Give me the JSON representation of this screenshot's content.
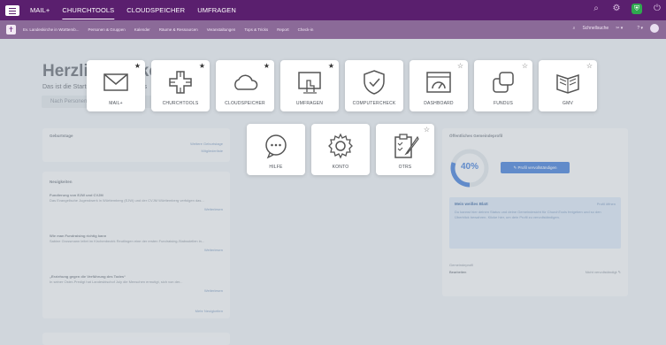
{
  "topnav": {
    "items": [
      "MAIL+",
      "CHURCHTOOLS",
      "CLOUDSPEICHER",
      "UMFRAGEN"
    ],
    "active": "CHURCHTOOLS"
  },
  "subbar": {
    "items": [
      "Ev. Landeskirche in Württemb...",
      "Personen & Gruppen",
      "Kalender",
      "Räume & Ressourcen",
      "Veranstaltungen",
      "Tops & Tricks",
      "Report",
      "Check-in"
    ],
    "search_placeholder": "Schnellsuche",
    "help": "?"
  },
  "dashboard": {
    "greeting": "Herzlich willkommen",
    "subtitle": "Das ist die Startseite von ChurchTools",
    "search_placeholder": "Nach Personen suchen",
    "birthdays": {
      "title": "Geburtstage",
      "link1": "Weitere Geburtstage",
      "link2": "Mitgliederliste"
    },
    "news": {
      "title": "Neuigkeiten",
      "items": [
        {
          "headline": "Fundierung von EJW und CVJM",
          "text": "Das Evangelische Jugendwerk in Württemberg (EJW) und der CVJM Württemberg verfolgen das...",
          "more": "Weiterlesen"
        },
        {
          "headline": "Wie man Fundraising richtig kann",
          "text": "Sabine Grossmann leitet im Kirchenbezirk Reutlingen eine der ersten Fundraising-Stabsstellen in...",
          "more": "Weiterlesen"
        },
        {
          "headline": "„Erziehung gegen die Verführung des Todes“",
          "text": "In seiner Oster-Predigt hat Landesbischof July die Menschen ermutigt, sich von der...",
          "more": "Weiterlesen"
        }
      ],
      "more_news": "Mehr Neuigkeiten"
    },
    "profile": {
      "title": "Öffentliches Gemeindeprofil",
      "percent": "40%",
      "button": "Profil vervollständigen",
      "note_title": "Mein weißes Blatt",
      "note_link": "Profil öffnen",
      "note_text": "Du kannst hier deinen Status und deine Gemeindesicht für ChurchTools freigeben und so den Überblick bewahren. Klicke hier, um dein Profil zu vervollständigen.",
      "field_label": "Gemeindeprofil",
      "field_value": "Bearbeiten",
      "field_right": "Nicht vervollständigt"
    }
  },
  "apps": [
    {
      "label": "MAIL+",
      "icon": "mail-icon",
      "fav": true
    },
    {
      "label": "CHURCHTOOLS",
      "icon": "churchtools-icon",
      "fav": true
    },
    {
      "label": "CLOUDSPEICHER",
      "icon": "cloud-icon",
      "fav": true
    },
    {
      "label": "UMFRAGEN",
      "icon": "survey-icon",
      "fav": true
    },
    {
      "label": "COMPUTERCHECK",
      "icon": "shield-check-icon",
      "fav": false
    },
    {
      "label": "DASHBOARD",
      "icon": "dashboard-icon",
      "fav": false
    },
    {
      "label": "FUNDUS",
      "icon": "fundus-icon",
      "fav": false
    },
    {
      "label": "GMV",
      "icon": "book-icon",
      "fav": false
    },
    {
      "label": "HILFE",
      "icon": "chat-bubble-icon",
      "fav": false
    },
    {
      "label": "KONTO",
      "icon": "gear-icon",
      "fav": false
    },
    {
      "label": "OTRS",
      "icon": "clipboard-icon",
      "fav": false
    }
  ],
  "colors": {
    "topbar": "#5a1f6e",
    "subbar": "#8b6a98",
    "accent": "#5b8ddb"
  }
}
